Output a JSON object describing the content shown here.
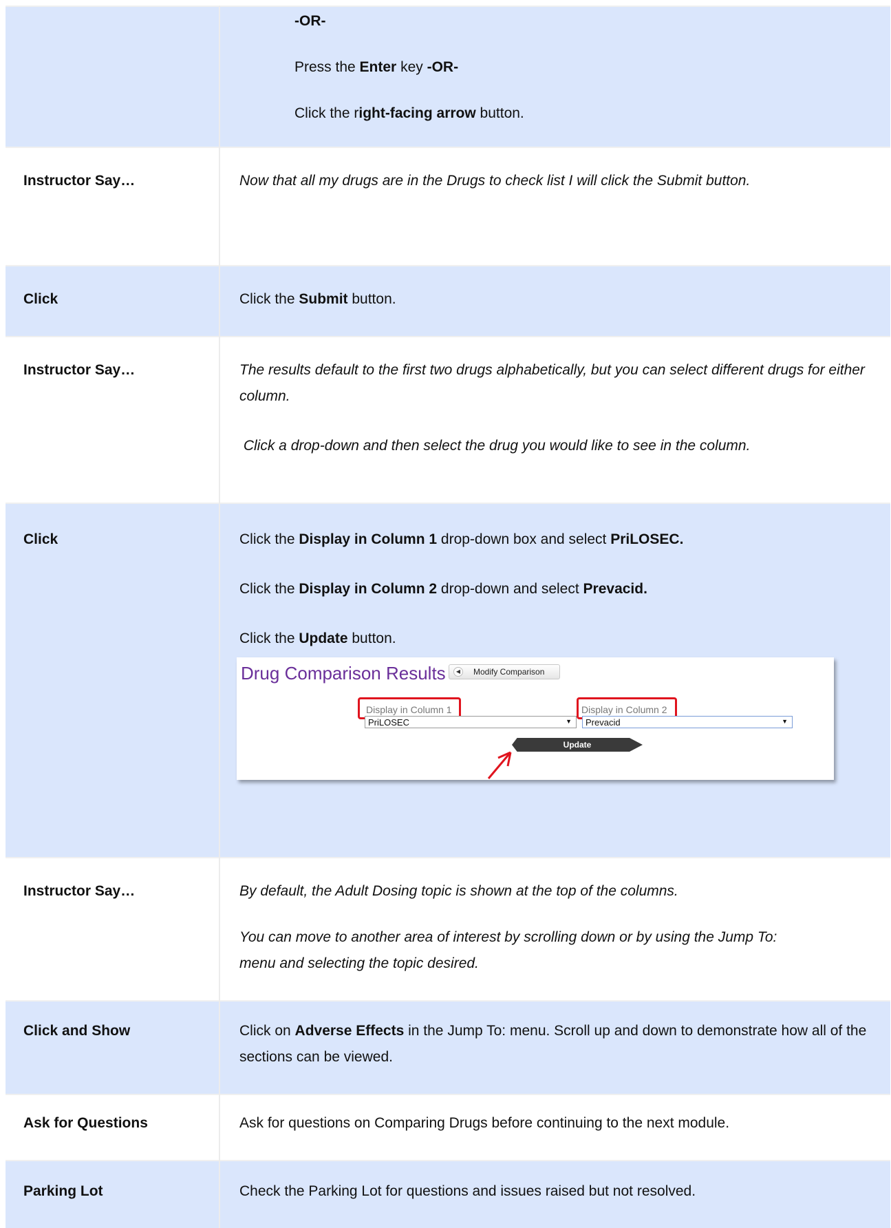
{
  "rows": {
    "row0": {
      "label": "",
      "lines": [
        {
          "bold1": "-OR-"
        },
        {
          "pre": "Press the ",
          "bold1": "Enter",
          "mid": " key ",
          "bold2": "-OR-"
        },
        {
          "pre": "Click the r",
          "bold1": "ight-facing arrow",
          "post": " button."
        }
      ]
    },
    "row1": {
      "label": "Instructor Say…",
      "text": "Now that all my drugs are in the Drugs to check list I will click the Submit button."
    },
    "row2": {
      "label": "Click",
      "pre": "Click the ",
      "bold": "Submit",
      "post": " button."
    },
    "row3": {
      "label": "Instructor Say…",
      "p1": "The results default to the first two drugs alphabetically, but you can select different drugs for either column.",
      "p2": " Click a drop-down and then select the drug you would like to see in the column."
    },
    "row4": {
      "label": "Click",
      "l1": {
        "pre": "Click the ",
        "b1": "Display in Column 1",
        "mid": " drop-down box and select ",
        "b2": "PriLOSEC."
      },
      "l2": {
        "pre": "Click the ",
        "b1": "Display in Column 2",
        "mid": " drop-down and select ",
        "b2": "Prevacid."
      },
      "l3": {
        "pre": "Click the ",
        "b1": "Update",
        "post": " button."
      },
      "screenshot": {
        "title": "Drug Comparison Results",
        "modify_button": "Modify Comparison",
        "col1_label": "Display in Column 1",
        "col1_value": "PriLOSEC",
        "col2_label": "Display in Column 2",
        "col2_value": "Prevacid",
        "update_button": "Update"
      }
    },
    "row5": {
      "label": "Instructor Say…",
      "p1": "By default, the Adult Dosing topic is shown at the top of the columns.",
      "p2": "You can move to another area of interest by scrolling down or by using the Jump To: menu and selecting the topic desired."
    },
    "row6": {
      "label": "Click and Show",
      "pre": "Click on ",
      "bold": "Adverse Effects",
      "post": " in the Jump To: menu. Scroll up and down to demonstrate how all of the sections can be viewed."
    },
    "row7": {
      "label": "Ask for Questions",
      "text": "Ask for questions on Comparing Drugs before continuing to the next module."
    },
    "row8": {
      "label": "Parking Lot",
      "text": "Check the Parking Lot for questions and issues raised but not resolved."
    }
  },
  "colors": {
    "row_shade": "#dae6fc",
    "title_purple": "#6a2f9a",
    "highlight_red": "#e0141e",
    "update_button": "#3a3a3a"
  }
}
